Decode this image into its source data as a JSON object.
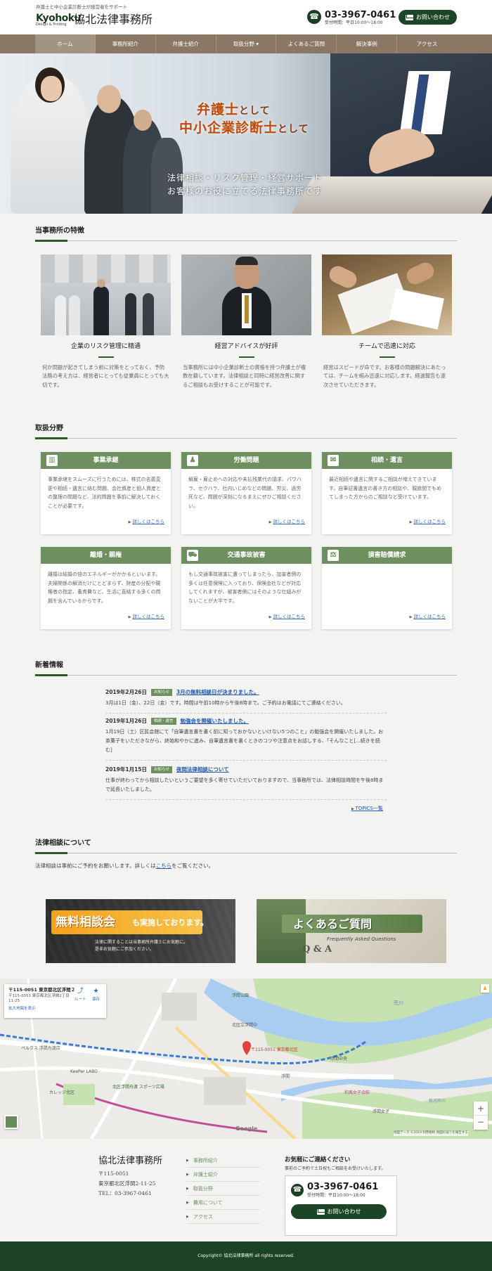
{
  "header": {
    "tagline": "弁護士と中小企業診断士が経営者をサポート",
    "logo_en": "Kyohoku",
    "logo_en_sub": "Design & Printing",
    "logo_jp": "協北法律事務所",
    "phone": "03-3967-0461",
    "hours": "受付時間：平日10:00〜18:00",
    "contact_label": "お問い合わせ"
  },
  "nav": [
    {
      "label": "ホーム",
      "active": true
    },
    {
      "label": "事務所紹介"
    },
    {
      "label": "弁護士紹介"
    },
    {
      "label": "取扱分野 ▾"
    },
    {
      "label": "よくあるご質問"
    },
    {
      "label": "解決事例"
    },
    {
      "label": "アクセス"
    }
  ],
  "hero": {
    "line1_main": "弁護士",
    "line1_small": "として",
    "line2_main": "中小企業診断士",
    "line2_small": "として",
    "sub1": "法律相談・リスク管理・経営サポート",
    "sub2": "お客様のお役に立てる法律事務所です"
  },
  "features": {
    "title": "当事務所の特徴",
    "items": [
      {
        "title": "企業のリスク管理に精通",
        "text": "何か問題が起きてしまう前に対策をとっておく、予防法務の考え方は、経営者にとっても従業員にとっても大切です。"
      },
      {
        "title": "経営アドバイスが好評",
        "text": "当事務所には中小企業診断士の資格を持つ弁護士が複数在籍しています。法律相談と同時に経営改善に関するご相談もお受けすることが可能です。"
      },
      {
        "title": "チームで迅速に対応",
        "text": "経営はスピードが命です。お客様の問題解決にあたっては、チームを組み迅速に対応します。経過報告も逐次させていただきます。"
      }
    ]
  },
  "practice": {
    "title": "取扱分野",
    "more_label": "詳しくはこちら",
    "items": [
      {
        "title": "事業承継",
        "icon": "building-icon",
        "glyph": "▥",
        "text": "事業承継をスムーズに行うためには、株式の名義変更や相続・遺言に絡む問題、会社資産と個人資産との整理の問題など、法的問題を事前に解決しておくことが必要です。"
      },
      {
        "title": "労働問題",
        "icon": "worker-icon",
        "glyph": "♟",
        "text": "解雇・雇止めへの対応や未払残業代の請求、パワハラ、セクハラ、社内いじめなどの問題、労災、過労死など、問題が深刻になるまえにぜひご相談ください。"
      },
      {
        "title": "相続・遺言",
        "icon": "chat-bubble-icon",
        "glyph": "✉",
        "text": "最近相続や遺言に関するご相談が増えてきています。自筆証書遺言の書き方の相談や、親族間でもめてしまった方からのご相談など受けています。"
      },
      {
        "title": "離婚・親権",
        "icon": "heart-icon",
        "glyph": "",
        "text": "離婚は結婚の倍のエネルギーがかかるといいます。夫婦関係の解消だけにとどまらず、財産の分配や親権者の指定、養育費など、生活に直結する多くの問題を含んでいるからです。"
      },
      {
        "title": "交通事故被害",
        "icon": "car-icon",
        "glyph": "⛟",
        "text": "もし交通事故被害に遭ってしまったら、加害者側の多くは任意保険に入っており、保険会社などが対応してくれますが、被害者側にはそのような仕組みがないことが大半です。"
      },
      {
        "title": "損害賠償請求",
        "icon": "scales-icon",
        "glyph": "⚖",
        "text": ""
      }
    ]
  },
  "news": {
    "title": "新着情報",
    "items": [
      {
        "date": "2019年2月26日",
        "badge": "お知らせ",
        "title": "3月の無料相談日が決まりました。",
        "text": "3月は1日（金）、22日（金）です。時間は午前10時から午後8時まで。ご予約はお電話にてご連絡ください。"
      },
      {
        "date": "2019年1月26日",
        "badge": "相続・遺言",
        "title": "勉強会を開催いたしました。",
        "text": "1月19日（土）区民会館にて「自筆遺言書を書く前に知っておかないといけない5つのこと」の勉強会を開催いたしました。お茶菓子をいただきながら、終始和やかに進み、自筆遺言書を書くときのコツや注意点をお話しする、「そんなこと[...続きを読む]"
      },
      {
        "date": "2019年1月15日",
        "badge": "お知らせ",
        "title": "夜間法律相談について",
        "text": "仕事が終わってから相談したいというご要望を多く寄せていただいておりますので、当事務所では、法律相談時間を午後8時まで延長いたしました。"
      }
    ],
    "more_label": "TOPICS一覧"
  },
  "consult": {
    "title": "法律相談について",
    "text_before": "法律相談は事前にご予約をお願いします。詳しくは",
    "link": "こちら",
    "text_after": "をご覧ください。",
    "banner1_main": "無料相談会",
    "banner1_tail": "も実施しております。",
    "banner1_sub1": "法律に関することは当事務所弁護士にお気軽に。",
    "banner1_sub2": "是非お気軽にご参加ください。",
    "banner2_main": "よくあるご質問",
    "banner2_sub": "Frequently Asked Questions",
    "banner2_qa": "Q & A"
  },
  "map": {
    "info_title": "〒115-0051 東京都北区浮間２...",
    "info_addr": "〒115-0051 東京都北区浮間2丁目11-25",
    "route": "ルート",
    "save": "保存",
    "enlarge": "拡大地図を表示",
    "pin_label": "〒115-0051 東京都北区",
    "labels": [
      "荒川",
      "浮間公園",
      "北区立浮間中",
      "ペルクス 浮間舟渡店",
      "KeePer LABO",
      "カレッジ北区",
      "北区浮間舟渡 スポーツ広場",
      "浮間",
      "浮間女子",
      "新河岸川",
      "浮間中央",
      "和風女子会館",
      "Google"
    ],
    "attribution": "地図データ ©2019 利用規約 地図の誤りを報告する"
  },
  "footer": {
    "office": "協北法律事務所",
    "zip": "〒115-0051",
    "addr": "東京都北区浮間2-11-25",
    "tel": "TEL：03-3967-0461",
    "links": [
      "事務所紹介",
      "弁護士紹介",
      "取扱分野",
      "費用について",
      "アクセス"
    ],
    "contact_title": "お気軽にご連絡ください",
    "contact_sub": "事前のご予約で土日祝もご相談をお受けいたします。",
    "phone": "03-3967-0461",
    "hours": "受付時間：平日10:00〜18:00",
    "contact_label": "お問い合わせ",
    "copyright": "Copyright© 協北法律事務所 all rights reserved."
  },
  "colors": {
    "brand_green": "#1c4324",
    "accent_green": "#6e8f5f",
    "nav_brown": "#8a7864",
    "hero_orange": "#c04a0a"
  }
}
